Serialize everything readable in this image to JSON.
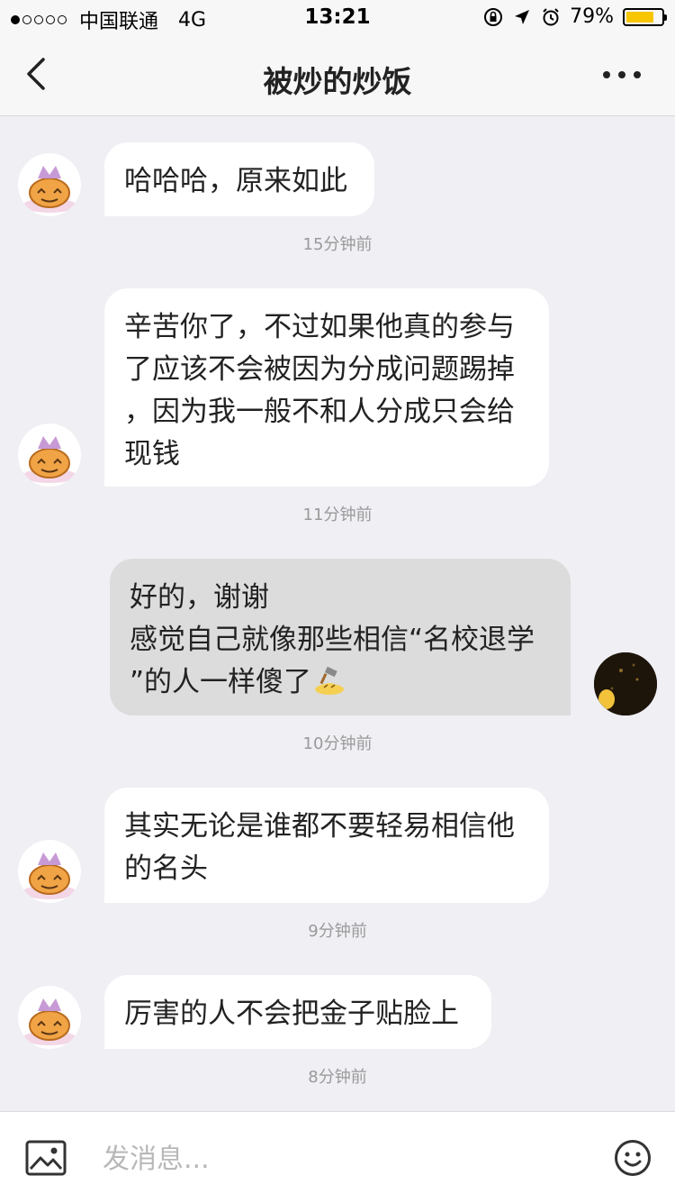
{
  "status_bar": {
    "carrier": "中国联通",
    "network": "4G",
    "time": "13:21",
    "battery_percent": "79%",
    "battery_level": 0.79,
    "icons": [
      "orientation-lock-icon",
      "location-arrow-icon",
      "alarm-icon"
    ]
  },
  "nav": {
    "title": "被炒的炒饭",
    "back_icon": "chevron-left-icon",
    "more_icon": "more-dots-icon"
  },
  "messages": [
    {
      "side": "in",
      "lines": [
        "哈哈哈，原来如此"
      ],
      "time": "15分钟前"
    },
    {
      "side": "in",
      "lines": [
        "辛苦你了，不过如果他真的参与",
        "了应该不会被因为分成问题踢掉",
        "，因为我一般不和人分成只会给",
        "现钱"
      ],
      "time": "11分钟前"
    },
    {
      "side": "out",
      "lines": [
        "好的，谢谢",
        "感觉自己就像那些相信“名校退学",
        "”的人一样傻了"
      ],
      "emoji": "hammer-head-emoji",
      "time": "10分钟前"
    },
    {
      "side": "in",
      "lines": [
        "其实无论是谁都不要轻易相信他",
        "的名头"
      ],
      "time": "9分钟前"
    },
    {
      "side": "in",
      "lines": [
        "厉害的人不会把金子贴脸上"
      ],
      "time": "8分钟前"
    }
  ],
  "input_bar": {
    "placeholder": "发消息...",
    "image_icon": "image-icon",
    "emoji_icon": "smiley-icon"
  },
  "colors": {
    "background": "#efeff4",
    "bubble_in": "#ffffff",
    "bubble_out": "#dcdcdc",
    "battery": "#f7c600"
  }
}
